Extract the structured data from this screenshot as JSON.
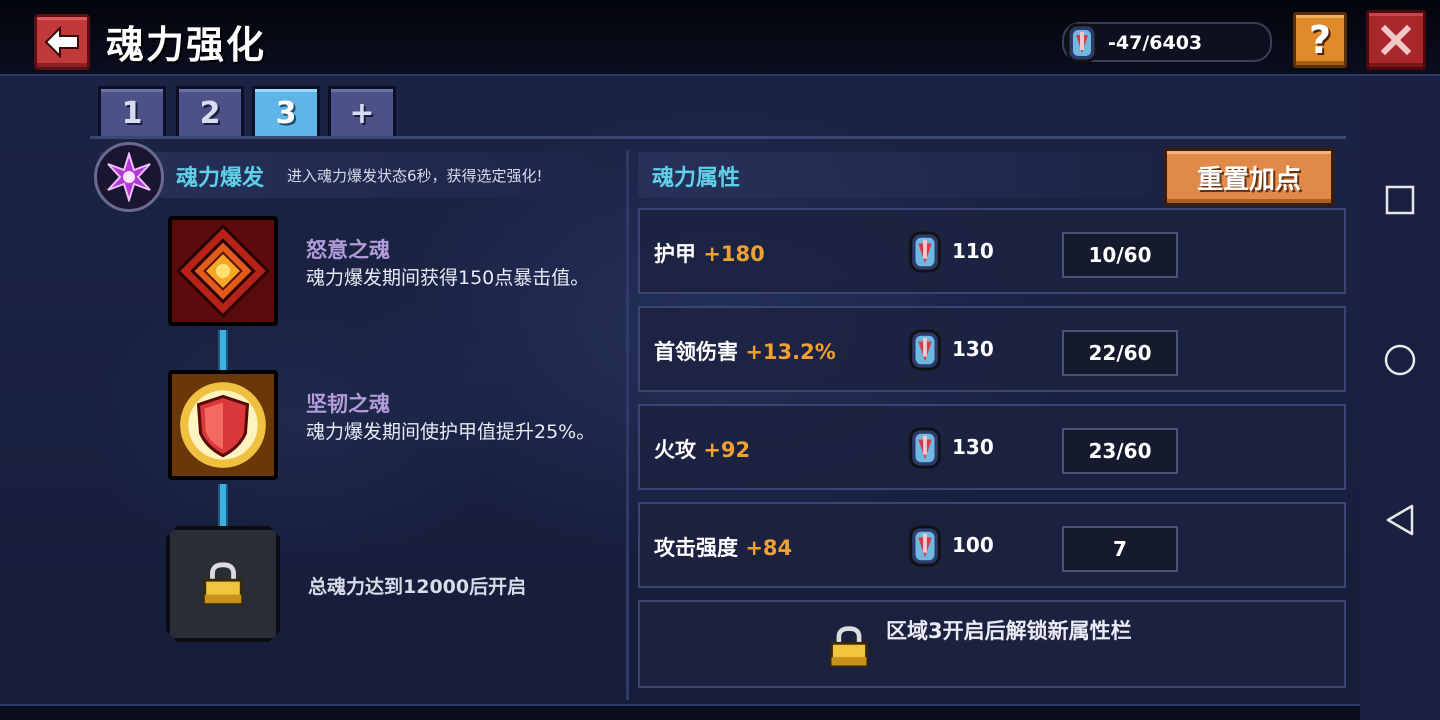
{
  "header": {
    "title": "魂力强化",
    "currency": "-47/6403"
  },
  "tabs": [
    {
      "label": "1",
      "active": false
    },
    {
      "label": "2",
      "active": false
    },
    {
      "label": "3",
      "active": true
    },
    {
      "label": "+",
      "active": false
    }
  ],
  "burst": {
    "title": "魂力爆发",
    "desc": "进入魂力爆发状态6秒，获得选定强化!"
  },
  "skills": [
    {
      "name": "怒意之魂",
      "desc": "魂力爆发期间获得150点暴击值。"
    },
    {
      "name": "坚韧之魂",
      "desc": "魂力爆发期间使护甲值提升25%。"
    }
  ],
  "locked_skill": {
    "text": "总魂力达到12000后开启"
  },
  "attributes": {
    "title": "魂力属性",
    "reset_label": "重置加点",
    "rows": [
      {
        "name": "护甲",
        "bonus": "+180",
        "cost": "110",
        "level": "10/60"
      },
      {
        "name": "首领伤害",
        "bonus": "+13.2%",
        "cost": "130",
        "level": "22/60"
      },
      {
        "name": "火攻",
        "bonus": "+92",
        "cost": "130",
        "level": "23/60"
      },
      {
        "name": "攻击强度",
        "bonus": "+84",
        "cost": "100",
        "level": "7"
      }
    ],
    "locked_text": "区域3开启后解锁新属性栏"
  },
  "colors": {
    "accent_cyan": "#5fd0e8",
    "bonus_orange": "#f0a030",
    "skill_purple": "#b19cd8",
    "tab_active": "#5fb4e8"
  }
}
